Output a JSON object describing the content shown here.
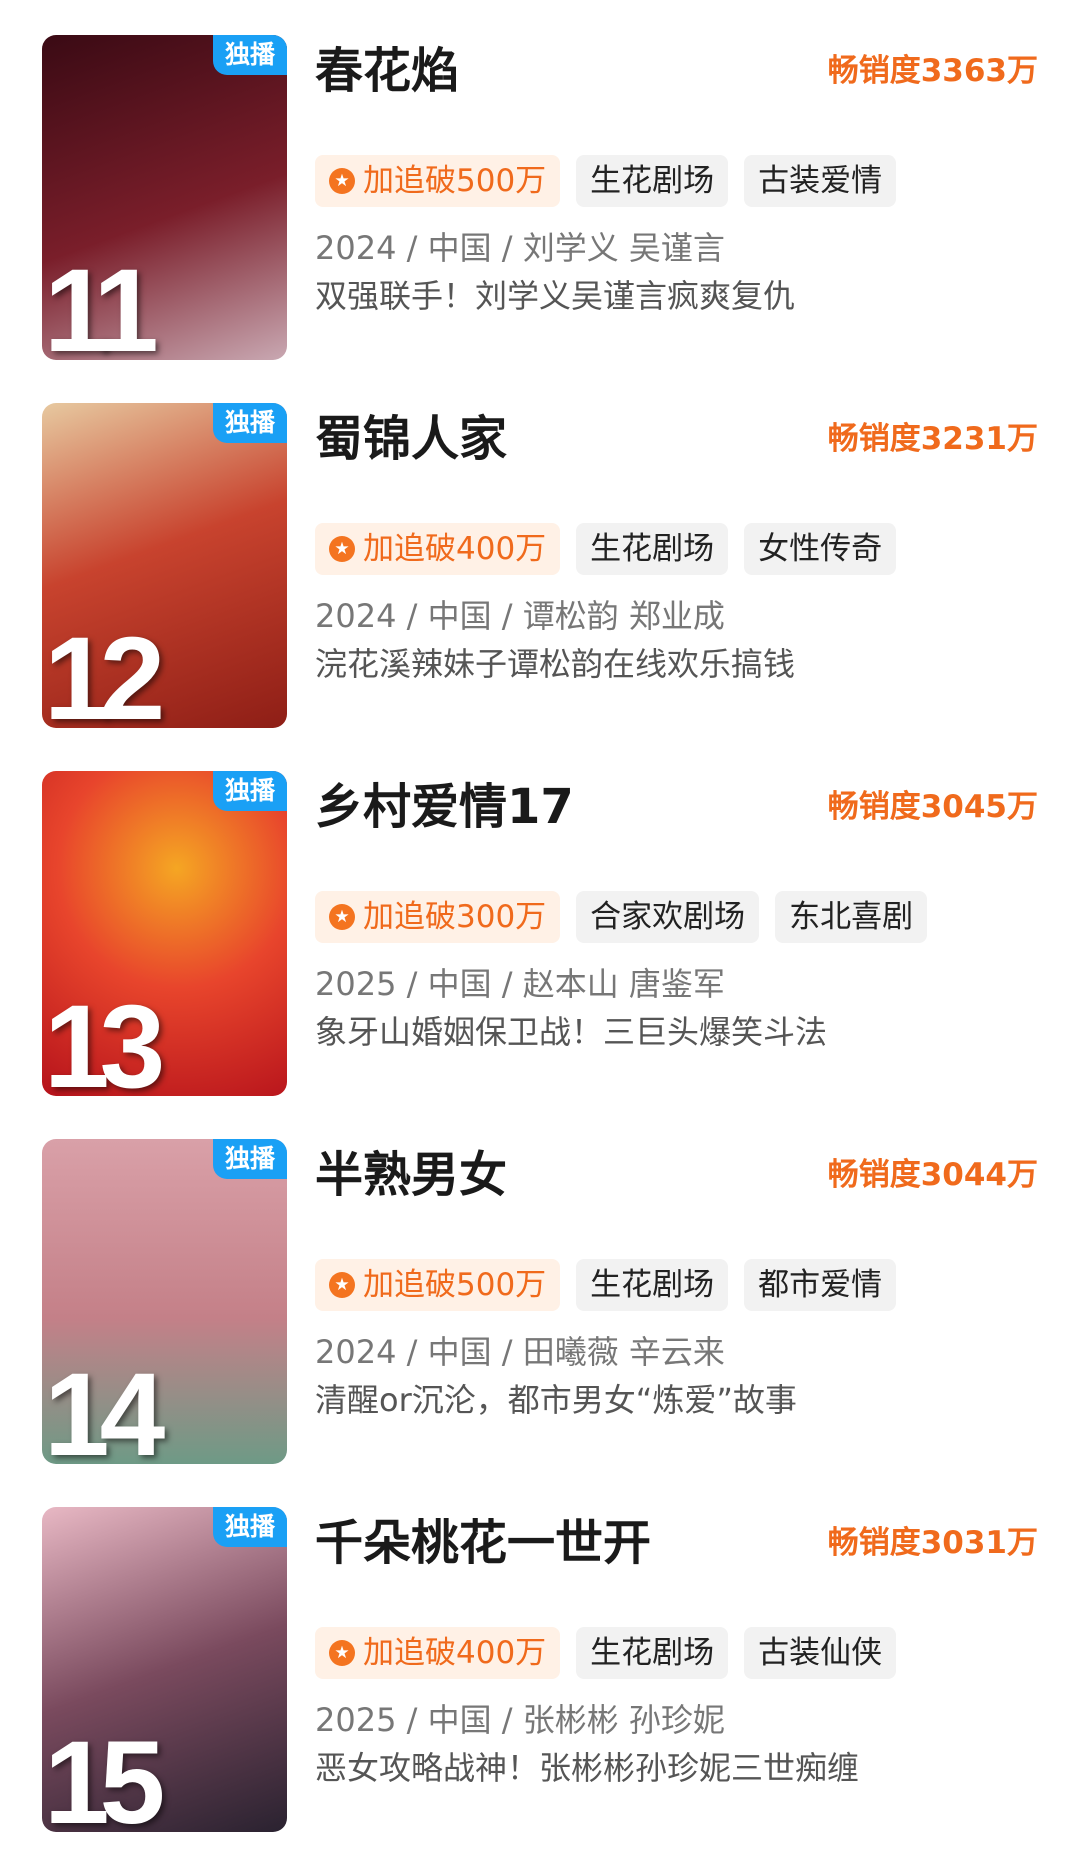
{
  "items": [
    {
      "rank": "11",
      "badge": "独播",
      "title": "春花焰",
      "sales": "畅销度3363万",
      "hot_tag": "加追破500万",
      "tags": [
        "生花剧场",
        "古装爱情"
      ],
      "meta": "2024 / 中国 / 刘学义 吴谨言",
      "desc": "双强联手！刘学义吴谨言疯爽复仇",
      "poster_colors": [
        "#3a0a14",
        "#7a1e2a",
        "#c9a8b2"
      ]
    },
    {
      "rank": "12",
      "badge": "独播",
      "title": "蜀锦人家",
      "sales": "畅销度3231万",
      "hot_tag": "加追破400万",
      "tags": [
        "生花剧场",
        "女性传奇"
      ],
      "meta": "2024 / 中国 / 谭松韵 郑业成",
      "desc": "浣花溪辣妹子谭松韵在线欢乐搞钱",
      "poster_colors": [
        "#8e1e16",
        "#c8432e",
        "#e7c9a0"
      ]
    },
    {
      "rank": "13",
      "badge": "独播",
      "title": "乡村爱情17",
      "sales": "畅销度3045万",
      "hot_tag": "加追破300万",
      "tags": [
        "合家欢剧场",
        "东北喜剧"
      ],
      "meta": "2025 / 中国 / 赵本山 唐鉴军",
      "desc": "象牙山婚姻保卫战！三巨头爆笑斗法",
      "poster_colors": [
        "#b5121b",
        "#e8452c",
        "#f5a623"
      ]
    },
    {
      "rank": "14",
      "badge": "独播",
      "title": "半熟男女",
      "sales": "畅销度3044万",
      "hot_tag": "加追破500万",
      "tags": [
        "生花剧场",
        "都市爱情"
      ],
      "meta": "2024 / 中国 / 田曦薇 辛云来",
      "desc": "清醒or沉沦，都市男女“炼爱”故事",
      "poster_colors": [
        "#d9a0a8",
        "#c48088",
        "#6e9a86"
      ]
    },
    {
      "rank": "15",
      "badge": "独播",
      "title": "千朵桃花一世开",
      "sales": "畅销度3031万",
      "hot_tag": "加追破400万",
      "tags": [
        "生花剧场",
        "古装仙侠"
      ],
      "meta": "2025 / 中国 / 张彬彬 孙珍妮",
      "desc": "恶女攻略战神！张彬彬孙珍妮三世痴缠",
      "poster_colors": [
        "#2a2230",
        "#7a4a5e",
        "#e8b8c4"
      ]
    }
  ]
}
